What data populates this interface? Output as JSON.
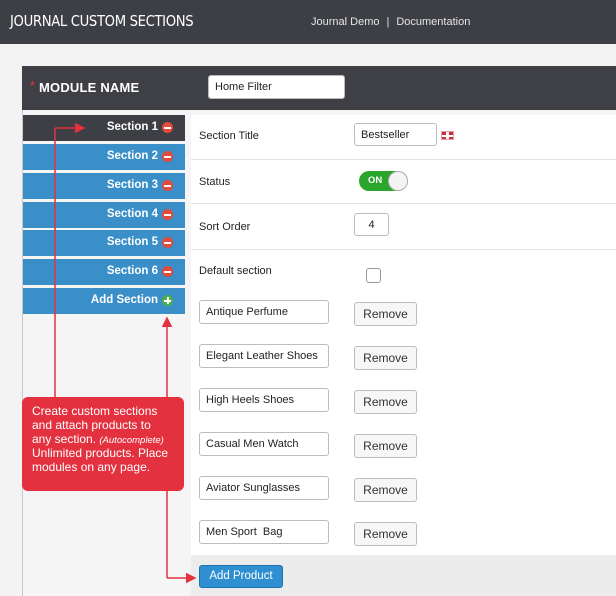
{
  "header": {
    "title": "JOURNAL CUSTOM SECTIONS",
    "links": [
      "Journal Demo",
      "Documentation"
    ],
    "separator": "|"
  },
  "module": {
    "required_mark": "*",
    "label": "MODULE NAME",
    "name_value": "Home Filter"
  },
  "sections": [
    {
      "label": "Section 1",
      "icon": "remove-icon",
      "active": true
    },
    {
      "label": "Section 2",
      "icon": "remove-icon",
      "active": false
    },
    {
      "label": "Section 3",
      "icon": "remove-icon",
      "active": false
    },
    {
      "label": "Section 4",
      "icon": "remove-icon",
      "active": false
    },
    {
      "label": "Section 5",
      "icon": "remove-icon",
      "active": false
    },
    {
      "label": "Section 6",
      "icon": "remove-icon",
      "active": false
    }
  ],
  "add_section_label": "Add Section",
  "form": {
    "section_title_label": "Section Title",
    "section_title_value": "Bestseller",
    "language_flag": "uk-flag-icon",
    "status_label": "Status",
    "status_toggle_text": "ON",
    "status_on": true,
    "sort_order_label": "Sort Order",
    "sort_order_value": "4",
    "default_section_label": "Default section",
    "default_section_checked": false
  },
  "products": [
    {
      "name": "Antique Perfume"
    },
    {
      "name": "Elegant Leather Shoes"
    },
    {
      "name": "High Heels Shoes"
    },
    {
      "name": "Casual Men Watch"
    },
    {
      "name": "Aviator Sunglasses"
    },
    {
      "name": "Men Sport  Bag"
    }
  ],
  "remove_label": "Remove",
  "add_product_label": "Add Product",
  "callout": {
    "line1": "Create custom sections",
    "line2": "and attach products to",
    "line3": "any section.",
    "autocomplete_note": "(Autocomplete)",
    "line4": "Unlimited products. Place",
    "line5": "modules on any page."
  },
  "colors": {
    "header_bg": "#3d3f45",
    "tab_blue": "#3a8fc9",
    "callout_red": "#e3313f",
    "toggle_green": "#2aa62c",
    "button_blue": "#2f8fd0"
  }
}
